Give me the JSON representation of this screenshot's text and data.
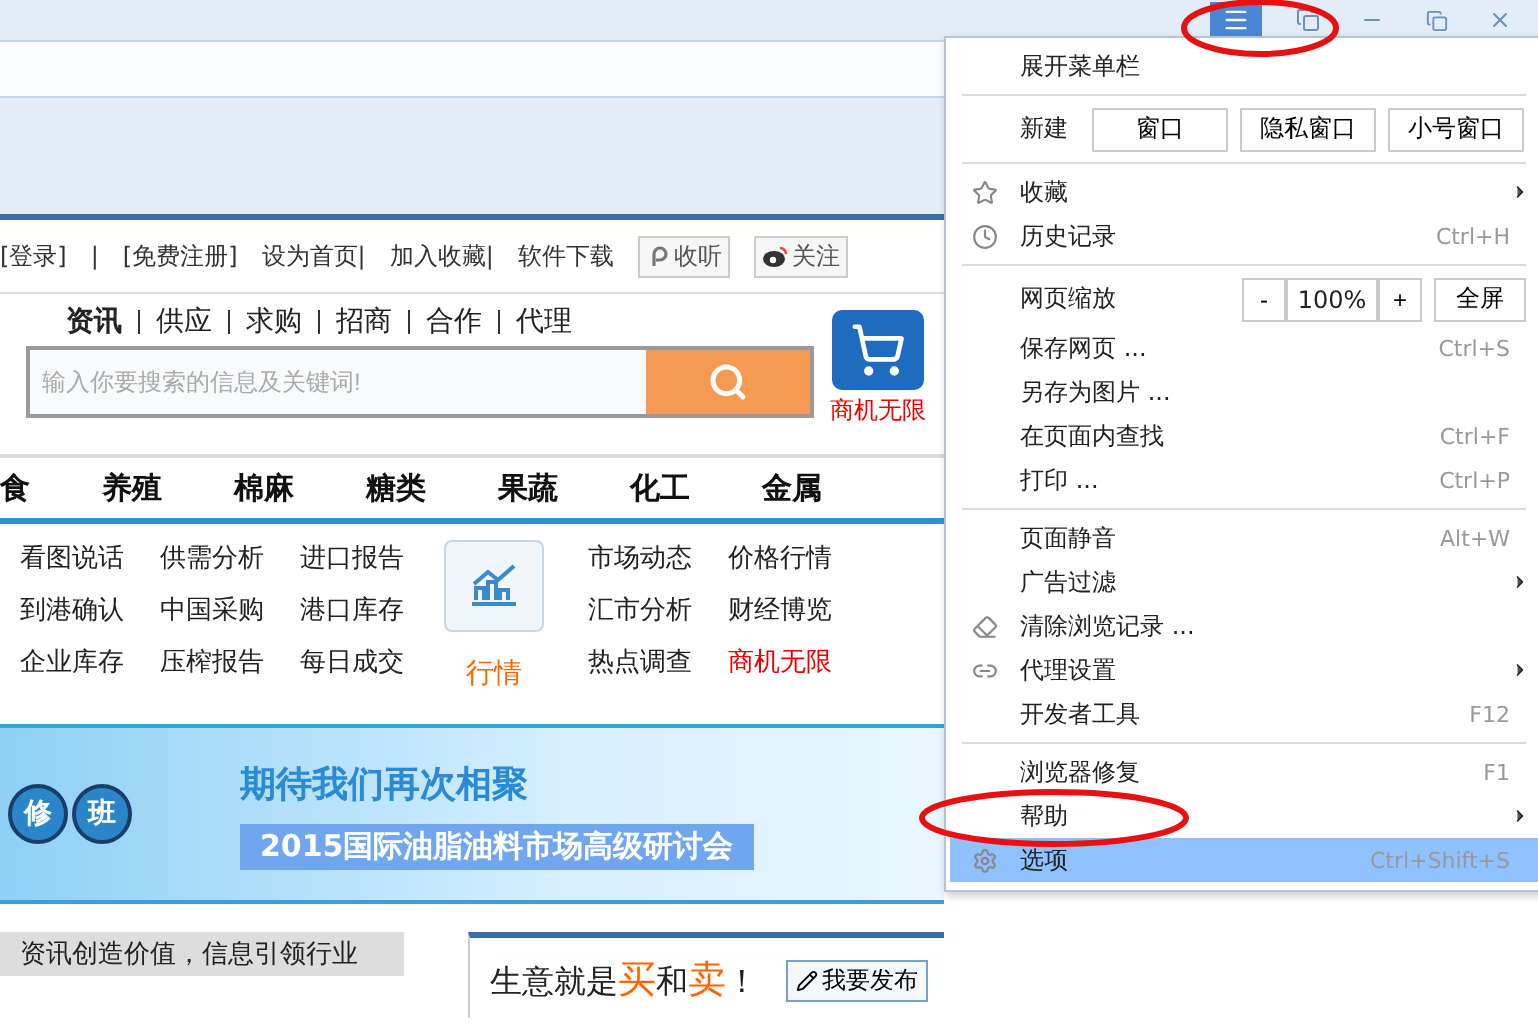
{
  "top_links": [
    {
      "label": "[登录]"
    },
    {
      "label": "|"
    },
    {
      "label": "[免费注册]"
    },
    {
      "label": "设为首页|"
    },
    {
      "label": "加入收藏|"
    },
    {
      "label": "软件下载"
    }
  ],
  "social_buttons": [
    {
      "label": "收听",
      "kind": "listen"
    },
    {
      "label": "关注",
      "kind": "follow"
    }
  ],
  "search": {
    "tabs": [
      {
        "label": "资讯",
        "selected": true
      },
      {
        "label": "供应",
        "selected": false
      },
      {
        "label": "求购",
        "selected": false
      },
      {
        "label": "招商",
        "selected": false
      },
      {
        "label": "合作",
        "selected": false
      },
      {
        "label": "代理",
        "selected": false
      }
    ],
    "placeholder": "输入你要搜索的信息及关键词!"
  },
  "promo": {
    "label": "商机无限"
  },
  "categories": [
    "食",
    "养殖",
    "棉麻",
    "糖类",
    "果蔬",
    "化工",
    "金属"
  ],
  "link_grid": [
    "看图说话",
    "供需分析",
    "进口报告",
    "到港确认",
    "中国采购",
    "港口库存",
    "企业库存",
    "压榨报告",
    "每日成交"
  ],
  "market": {
    "label": "行情"
  },
  "market_links": [
    {
      "label": "市场动态",
      "highlighted": false
    },
    {
      "label": "价格行情",
      "highlighted": false
    },
    {
      "label": "汇市分析",
      "highlighted": false
    },
    {
      "label": "财经博览",
      "highlighted": false
    },
    {
      "label": "热点调查",
      "highlighted": false
    },
    {
      "label": "商机无限",
      "highlighted": true
    }
  ],
  "banner": {
    "badges": [
      "修",
      "班"
    ],
    "headline": "期待我们再次相聚",
    "title": "2015国际油脂油料市场高级研讨会"
  },
  "slogan": "资讯创造价值，信息引领行业",
  "trade_box": {
    "parts": [
      {
        "text": "生意就是",
        "accent": false
      },
      {
        "text": "买",
        "accent": true
      },
      {
        "text": "和",
        "accent": false
      },
      {
        "text": "卖",
        "accent": true
      },
      {
        "text": "！",
        "accent": false
      }
    ],
    "button": "我要发布"
  },
  "menu": {
    "items": [
      {
        "kind": "item",
        "label": "展开菜单栏",
        "submenu": false,
        "selected": false
      },
      {
        "kind": "divider"
      },
      {
        "kind": "new_row",
        "label": "新建",
        "buttons": [
          "窗口",
          "隐私窗口",
          "小号窗口"
        ]
      },
      {
        "kind": "divider"
      },
      {
        "kind": "item",
        "label": "收藏",
        "submenu": true,
        "selected": false
      },
      {
        "kind": "item",
        "label": "历史记录",
        "shortcut": "Ctrl+H",
        "submenu": false,
        "selected": false
      },
      {
        "kind": "divider"
      },
      {
        "kind": "zoom_row",
        "label": "网页缩放",
        "minus": "-",
        "value": "100%",
        "plus": "+",
        "fullscreen": "全屏"
      },
      {
        "kind": "item",
        "label": "保存网页 ...",
        "shortcut": "Ctrl+S",
        "submenu": false,
        "selected": false
      },
      {
        "kind": "item",
        "label": "另存为图片 ...",
        "submenu": false,
        "selected": false
      },
      {
        "kind": "item",
        "label": "在页面内查找",
        "shortcut": "Ctrl+F",
        "submenu": false,
        "selected": false
      },
      {
        "kind": "item",
        "label": "打印 ...",
        "shortcut": "Ctrl+P",
        "submenu": false,
        "selected": false
      },
      {
        "kind": "divider"
      },
      {
        "kind": "item",
        "label": "页面静音",
        "shortcut": "Alt+W",
        "submenu": false,
        "selected": false
      },
      {
        "kind": "item",
        "label": "广告过滤",
        "submenu": true,
        "selected": false
      },
      {
        "kind": "item",
        "label": "清除浏览记录 ...",
        "submenu": false,
        "selected": false
      },
      {
        "kind": "item",
        "label": "代理设置",
        "submenu": true,
        "selected": false
      },
      {
        "kind": "item",
        "label": "开发者工具",
        "shortcut": "F12",
        "submenu": false,
        "selected": false
      },
      {
        "kind": "divider"
      },
      {
        "kind": "item",
        "label": "浏览器修复",
        "shortcut": "F1",
        "submenu": false,
        "selected": false
      },
      {
        "kind": "item",
        "label": "帮助",
        "submenu": true,
        "selected": false
      },
      {
        "kind": "item",
        "label": "选项",
        "shortcut": "Ctrl+Shift+S",
        "submenu": false,
        "selected": true
      }
    ]
  }
}
